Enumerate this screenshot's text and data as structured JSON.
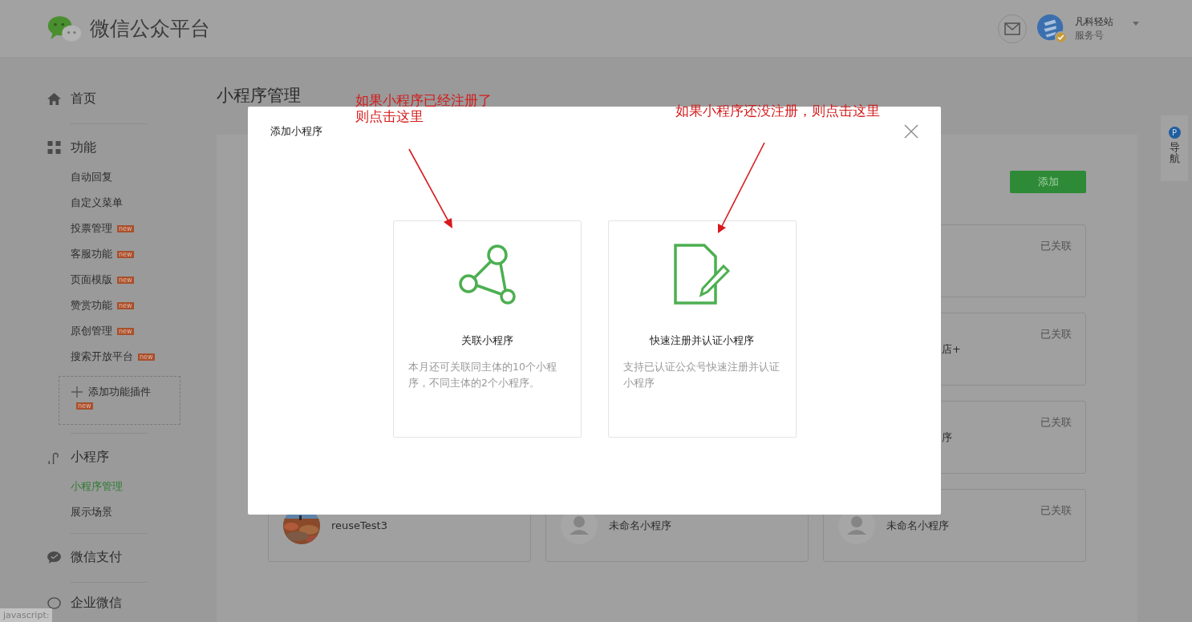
{
  "header": {
    "title": "微信公众平台",
    "account": {
      "name": "凡科轻站",
      "type": "服务号"
    }
  },
  "sidebar": {
    "sections": [
      {
        "label": "首页"
      },
      {
        "label": "功能",
        "items": [
          {
            "label": "自动回复",
            "selected": false
          },
          {
            "label": "自定义菜单",
            "selected": false
          },
          {
            "label": "投票管理",
            "badge": "new",
            "selected": false
          },
          {
            "label": "客服功能",
            "badge": "new",
            "selected": false
          },
          {
            "label": "页面模版",
            "badge": "new",
            "selected": false
          },
          {
            "label": "赞赏功能",
            "badge": "new",
            "selected": false
          },
          {
            "label": "原创管理",
            "badge": "new",
            "selected": false
          },
          {
            "label": "搜索开放平台",
            "badge": "new",
            "selected": false
          }
        ],
        "plugin_button": {
          "label": "添加功能插件",
          "badge": "new"
        }
      },
      {
        "label": "小程序",
        "items": [
          {
            "label": "小程序管理",
            "selected": true
          },
          {
            "label": "展示场景",
            "selected": false
          }
        ]
      },
      {
        "label": "微信支付"
      },
      {
        "label": "企业微信"
      }
    ]
  },
  "page": {
    "title": "小程序管理",
    "add_button": "添加",
    "cards": [
      {
        "kind": "partial",
        "status": "已关联"
      },
      {
        "kind": "partial",
        "name": "店+",
        "status": "已关联"
      },
      {
        "kind": "partial",
        "name": "序",
        "status": "已关联"
      },
      {
        "name": "reuseTest3"
      },
      {
        "kind": "default",
        "name": "未命名小程序"
      },
      {
        "kind": "default",
        "name": "未命名小程序",
        "status": "已关联"
      }
    ]
  },
  "side_nav": {
    "badge": "P",
    "label": "导航"
  },
  "modal": {
    "title": "添加小程序",
    "options": [
      {
        "kind": "link",
        "title": "关联小程序",
        "description": "本月还可关联同主体的10个小程序，不同主体的2个小程序。"
      },
      {
        "kind": "register",
        "title": "快速注册并认证小程序",
        "description": "支持已认证公众号快速注册并认证小程序"
      }
    ]
  },
  "annotations": [
    {
      "lines": [
        "如果小程序已经注册了",
        "则点击这里"
      ]
    },
    {
      "lines": [
        "如果小程序还没注册，则点击这里"
      ]
    }
  ],
  "status_bar": "javascript:"
}
